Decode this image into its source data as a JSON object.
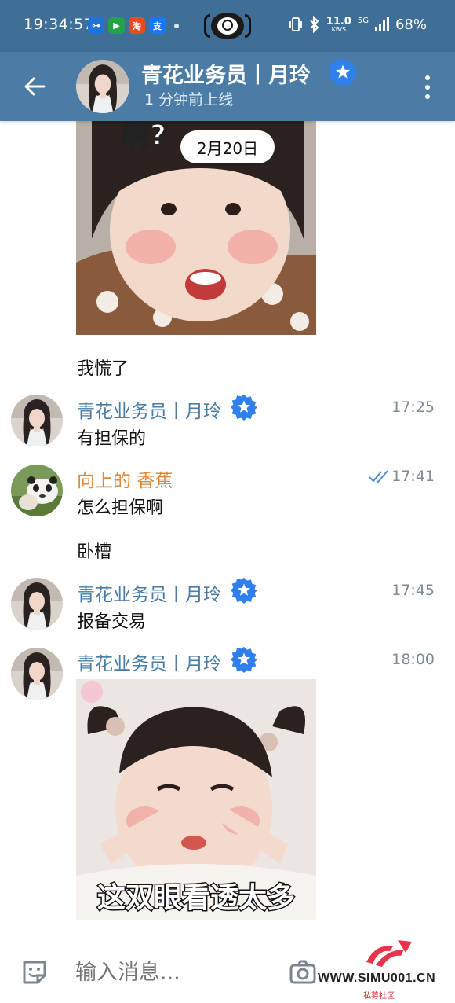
{
  "status_bar": {
    "time": "19:34:57",
    "apps": [
      {
        "icon": "key-icon",
        "glyph": "⊶",
        "color": "#1e73d8"
      },
      {
        "icon": "video-app-icon",
        "glyph": "▶",
        "color": "#22a345"
      },
      {
        "icon": "taobao-icon",
        "glyph": "淘",
        "color": "#e94b22"
      },
      {
        "icon": "alipay-icon",
        "glyph": "支",
        "color": "#1677ff"
      }
    ],
    "net_speed": "11.0",
    "net_unit": "KB/S",
    "network": "5G",
    "battery": "68%"
  },
  "header": {
    "title": "青花业务员丨月玲",
    "status": "1 分钟前上线"
  },
  "date_label": "2月20日",
  "messages": [
    {
      "text": "我慌了"
    },
    {
      "sender": "青花业务员丨月玲",
      "time": "17:25",
      "text": "有担保的"
    },
    {
      "sender": "向上的 香蕉",
      "time": "17:41",
      "text": "怎么担保啊"
    },
    {
      "text": "卧槽"
    },
    {
      "sender": "青花业务员丨月玲",
      "time": "17:45",
      "text": "报备交易"
    },
    {
      "sender": "青花业务员丨月玲",
      "time": "18:00",
      "sticker_caption": "这双眼看透太多"
    }
  ],
  "sticker_top": {
    "text": "啊?"
  },
  "input": {
    "placeholder": "输入消息..."
  },
  "watermark": {
    "text": "WWW.SIMU001.CN",
    "sub": "私募社区"
  },
  "colors": {
    "header": "#4a7ca5",
    "statusbar": "#3f6f96",
    "name_blue": "#4a7ca5",
    "name_orange": "#e0873a",
    "verified": "#2f80ed"
  }
}
